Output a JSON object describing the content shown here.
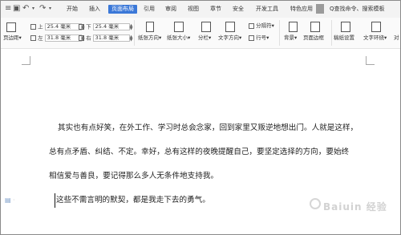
{
  "quick_access": {
    "menu_icon": "menu-icon",
    "undo_icon": "undo-icon",
    "redo_icon": "redo-icon",
    "dropdown": "▾"
  },
  "tabs": [
    "开始",
    "插入",
    "页面布局",
    "引用",
    "审阅",
    "视图",
    "章节",
    "安全",
    "开发工具",
    "特色应用"
  ],
  "active_tab": "页面布局",
  "search": {
    "label": "Q查找命令、搜索模板"
  },
  "ribbon": {
    "margins_label": "页边距",
    "top_label": "上",
    "top_value": "25.4 毫米",
    "bottom_label": "下",
    "bottom_value": "25.4 毫米",
    "left_label": "左",
    "left_value": "31.8 毫米",
    "right_label": "右",
    "right_value": "31.8 毫米",
    "orientation_label": "纸张方向",
    "size_label": "纸张大小",
    "columns_label": "分栏",
    "text_direction_label": "文字方向",
    "separator_label": "分隔符",
    "line_number_label": "行号",
    "background_label": "背景",
    "page_border_label": "页面边框",
    "draft_paper_label": "稿纸设置",
    "text_wrap_label": "文字环绕",
    "align_label": "对"
  },
  "document": {
    "lines": [
      "其实也有点好笑，在外工作、学习时总会念家，回到家里又叛逆地想出门。人就是这样，",
      "总有点矛盾、纠结、不定。幸好，总有这样的夜晚提醒自己，要坚定选择的方向，要始终",
      "相信爱与善良，要记得那么多人无条件地支持我。",
      "这些不需言明的默契，都是我走下去的勇气。"
    ]
  },
  "watermark": {
    "text": "Baiuin 经验"
  }
}
